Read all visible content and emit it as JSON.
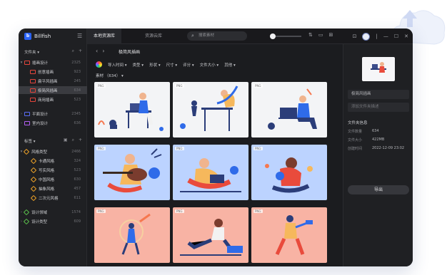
{
  "app": {
    "name": "Billfish"
  },
  "tabs": [
    {
      "label": "本地资源库"
    },
    {
      "label": "资源云库"
    }
  ],
  "sidebar": {
    "folders_header": "文件夹",
    "folders": [
      {
        "label": "插画设计",
        "count": "2325"
      },
      {
        "label": "创意插画",
        "count": "923"
      },
      {
        "label": "扁平风插画",
        "count": "245"
      },
      {
        "label": "极简风插画",
        "count": "634"
      },
      {
        "label": "商用插画",
        "count": "523"
      },
      {
        "label": "平面设计",
        "count": "2345"
      },
      {
        "label": "室内设计",
        "count": "636"
      }
    ],
    "tags_header": "标签",
    "tags": [
      {
        "label": "风格类型",
        "count": "2466"
      },
      {
        "label": "卡通风格",
        "count": "324"
      },
      {
        "label": "写实风格",
        "count": "523"
      },
      {
        "label": "中国风格",
        "count": "630"
      },
      {
        "label": "抽象风格",
        "count": "457"
      },
      {
        "label": "二次元风格",
        "count": "611"
      },
      {
        "label": "设计领域",
        "count": "1574"
      },
      {
        "label": "设计类型",
        "count": "609"
      }
    ]
  },
  "toolbar": {
    "breadcrumb": "极简风插画",
    "search_placeholder": "搜索素材"
  },
  "filters": [
    "导入时间",
    "类型",
    "形状",
    "尺寸",
    "评分",
    "文件大小",
    "其他"
  ],
  "count_label": "素材 （634）",
  "badge": "PNG",
  "inspector": {
    "name": "极简风插画",
    "desc_placeholder": "添加文件夹描述",
    "section": "文件夹信息",
    "rows": [
      {
        "k": "文件数量",
        "v": "634"
      },
      {
        "k": "文件大小",
        "v": "422MB"
      },
      {
        "k": "创建时间",
        "v": "2022-12-09 23:02"
      }
    ],
    "export": "导出"
  },
  "colors": {
    "accent": "#2a63f6",
    "active_folder": "#3a3b40"
  }
}
